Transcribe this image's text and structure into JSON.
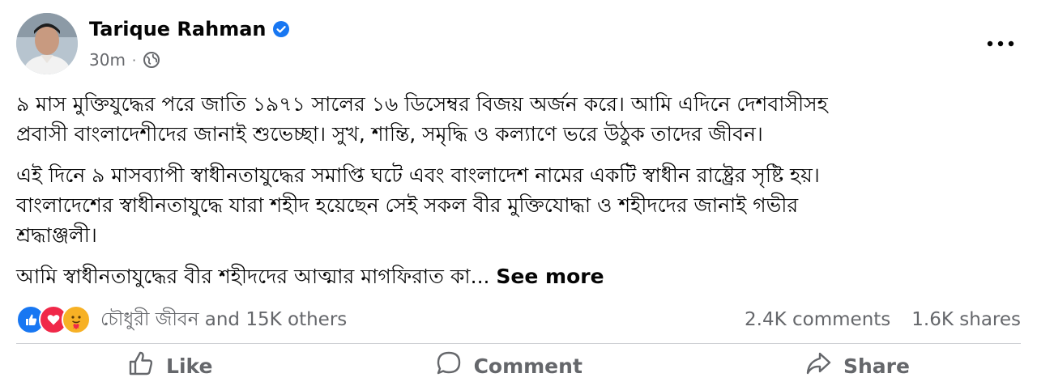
{
  "post": {
    "author": "Tarique Rahman",
    "time": "30m",
    "dot": "·",
    "paragraphs": [
      [
        "৯ মাস মুক্তিযুদ্ধের পরে জাতি ১৯৭১ সালের ১৬ ডিসেম্বর বিজয় অর্জন করে। আমি এদিনে দেশবাসীসহ",
        "প্রবাসী বাংলাদেশীদের জানাই শুভেচ্ছা। সুখ, শান্তি, সমৃদ্ধি ও কল্যাণে ভরে উঠুক তাদের জীবন।"
      ],
      [
        "এই দিনে ৯ মাসব্যাপী স্বাধীনতাযুদ্ধের সমাপ্তি ঘটে এবং বাংলাদেশ নামের একটি স্বাধীন রাষ্ট্রের সৃষ্টি হয়।",
        "বাংলাদেশের স্বাধীনতাযুদ্ধে যারা শহীদ হয়েছেন সেই সকল বীর মুক্তিযোদ্ধা ও শহীদদের জানাই গভীর",
        "শ্রদ্ধাঞ্জলী।"
      ]
    ],
    "last_line": "আমি স্বাধীনতাযুদ্ধের বীর শহীদদের আত্মার মাগফিরাত কা...",
    "see_more": "See more"
  },
  "reactions": {
    "icons": [
      "like-icon",
      "love-icon",
      "care-icon"
    ],
    "summary": "চৌধুরী জীবন and 15K others",
    "comments": "2.4K comments",
    "shares": "1.6K shares"
  },
  "actions": {
    "like": "Like",
    "comment": "Comment",
    "share": "Share"
  },
  "colors": {
    "blue": "#1877f2",
    "red": "#f02849",
    "yellow": "#f7b125",
    "secondary_text": "#65676b"
  }
}
